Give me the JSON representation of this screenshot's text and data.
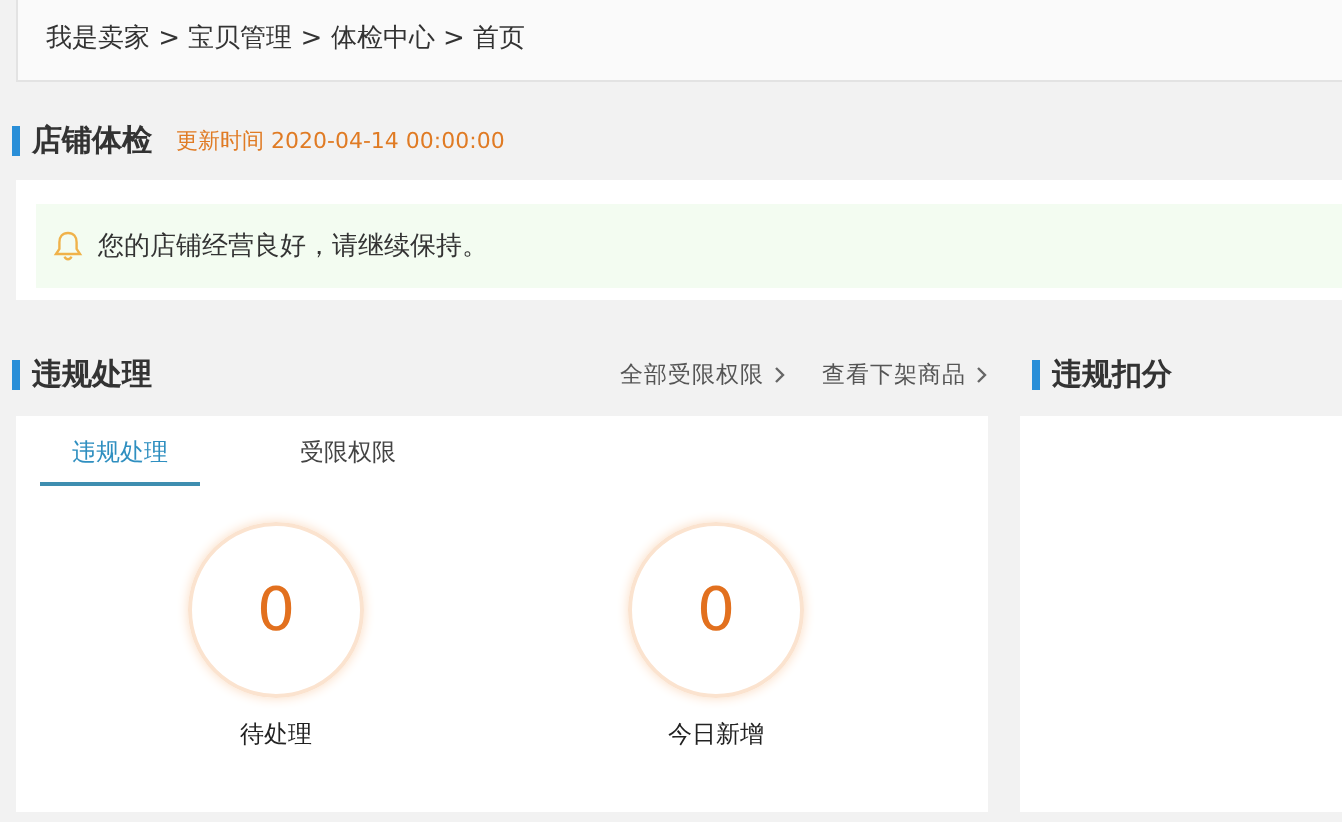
{
  "breadcrumb": "我是卖家 > 宝贝管理 > 体检中心 > 首页",
  "health": {
    "title": "店铺体检",
    "updated": "更新时间 2020-04-14 00:00:00",
    "notice": "您的店铺经营良好，请继续保持。"
  },
  "violations": {
    "title": "违规处理",
    "links": [
      "全部受限权限",
      "查看下架商品"
    ],
    "tabs": [
      {
        "label": "违规处理",
        "selected": true
      },
      {
        "label": "受限权限",
        "selected": false
      }
    ],
    "stats": [
      {
        "value": "0",
        "label": "待处理"
      },
      {
        "value": "0",
        "label": "今日新增"
      }
    ]
  },
  "deductions": {
    "title": "违规扣分"
  }
}
